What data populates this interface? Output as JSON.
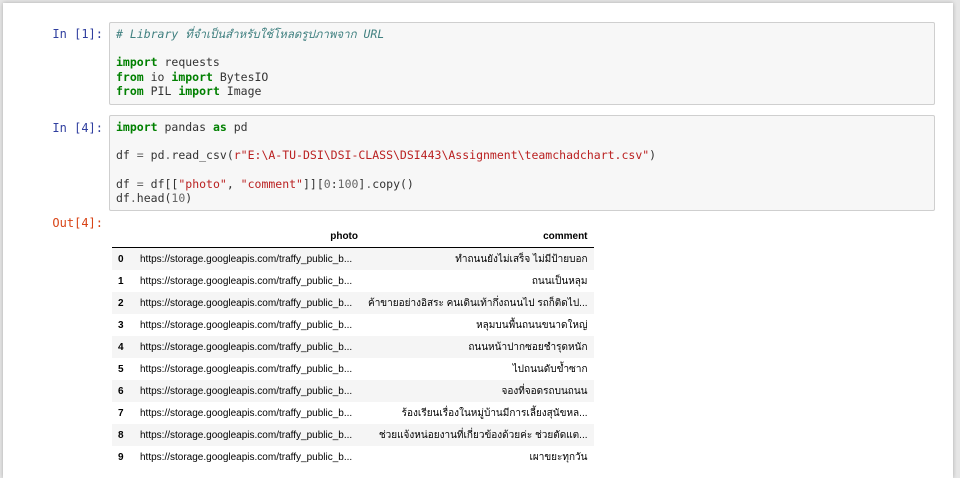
{
  "cells": [
    {
      "prompt": "In [1]:",
      "lines": [
        [
          {
            "t": "cm",
            "v": "# Library ที่จำเป็นสำหรับใช้โหลดรูปภาพจาก URL"
          }
        ],
        [],
        [
          {
            "t": "kw",
            "v": "import"
          },
          {
            "t": "",
            "v": " requests"
          }
        ],
        [
          {
            "t": "kw",
            "v": "from"
          },
          {
            "t": "",
            "v": " io "
          },
          {
            "t": "kw",
            "v": "import"
          },
          {
            "t": "",
            "v": " BytesIO"
          }
        ],
        [
          {
            "t": "kw",
            "v": "from"
          },
          {
            "t": "",
            "v": " PIL "
          },
          {
            "t": "kw",
            "v": "import"
          },
          {
            "t": "",
            "v": " Image"
          }
        ]
      ]
    },
    {
      "prompt": "In [4]:",
      "lines": [
        [
          {
            "t": "kw",
            "v": "import"
          },
          {
            "t": "",
            "v": " pandas "
          },
          {
            "t": "kw",
            "v": "as"
          },
          {
            "t": "",
            "v": " pd"
          }
        ],
        [],
        [
          {
            "t": "",
            "v": "df "
          },
          {
            "t": "op",
            "v": "="
          },
          {
            "t": "",
            "v": " pd"
          },
          {
            "t": "op",
            "v": "."
          },
          {
            "t": "",
            "v": "read_csv("
          },
          {
            "t": "st",
            "v": "r\"E:\\A-TU-DSI\\DSI-CLASS\\DSI443\\Assignment\\teamchadchart.csv\""
          },
          {
            "t": "",
            "v": ")"
          }
        ],
        [],
        [
          {
            "t": "",
            "v": "df "
          },
          {
            "t": "op",
            "v": "="
          },
          {
            "t": "",
            "v": " df[["
          },
          {
            "t": "st",
            "v": "\"photo\""
          },
          {
            "t": "",
            "v": ", "
          },
          {
            "t": "st",
            "v": "\"comment\""
          },
          {
            "t": "",
            "v": "]]["
          },
          {
            "t": "num",
            "v": "0"
          },
          {
            "t": "",
            "v": ":"
          },
          {
            "t": "num",
            "v": "100"
          },
          {
            "t": "",
            "v": "]"
          },
          {
            "t": "op",
            "v": "."
          },
          {
            "t": "",
            "v": "copy()"
          }
        ],
        [
          {
            "t": "",
            "v": "df"
          },
          {
            "t": "op",
            "v": "."
          },
          {
            "t": "",
            "v": "head("
          },
          {
            "t": "num",
            "v": "10"
          },
          {
            "t": "",
            "v": ")"
          }
        ]
      ]
    }
  ],
  "output": {
    "prompt": "Out[4]:",
    "columns": [
      "photo",
      "comment"
    ],
    "rows": [
      {
        "index": "0",
        "photo": "https://storage.googleapis.com/traffy_public_b...",
        "comment": "ทำถนนยังไม่เสร็จ ไม่มีป้ายบอก"
      },
      {
        "index": "1",
        "photo": "https://storage.googleapis.com/traffy_public_b...",
        "comment": "ถนนเป็นหลุม"
      },
      {
        "index": "2",
        "photo": "https://storage.googleapis.com/traffy_public_b...",
        "comment": "ค้าขายอย่างอิสระ คนเดินเท้ากึ่งถนนไป รถก็ติดไป..."
      },
      {
        "index": "3",
        "photo": "https://storage.googleapis.com/traffy_public_b...",
        "comment": "หลุมบนพื้นถนนขนาดใหญ่"
      },
      {
        "index": "4",
        "photo": "https://storage.googleapis.com/traffy_public_b...",
        "comment": "ถนนหน้าปากซอยชำรุดหนัก"
      },
      {
        "index": "5",
        "photo": "https://storage.googleapis.com/traffy_public_b...",
        "comment": "ไปถนนดับข้ำซาก"
      },
      {
        "index": "6",
        "photo": "https://storage.googleapis.com/traffy_public_b...",
        "comment": "จองที่จอดรถบนถนน"
      },
      {
        "index": "7",
        "photo": "https://storage.googleapis.com/traffy_public_b...",
        "comment": "ร้องเรียนเรื่องในหมู่บ้านมีการเลี้ยงสุนัขหล..."
      },
      {
        "index": "8",
        "photo": "https://storage.googleapis.com/traffy_public_b...",
        "comment": "ช่วยแจ้งหน่อยงานที่เกี่ยวข้องด้วยค่ะ ช่วยตัดแต..."
      },
      {
        "index": "9",
        "photo": "https://storage.googleapis.com/traffy_public_b...",
        "comment": "เผาขยะทุกวัน"
      }
    ]
  }
}
